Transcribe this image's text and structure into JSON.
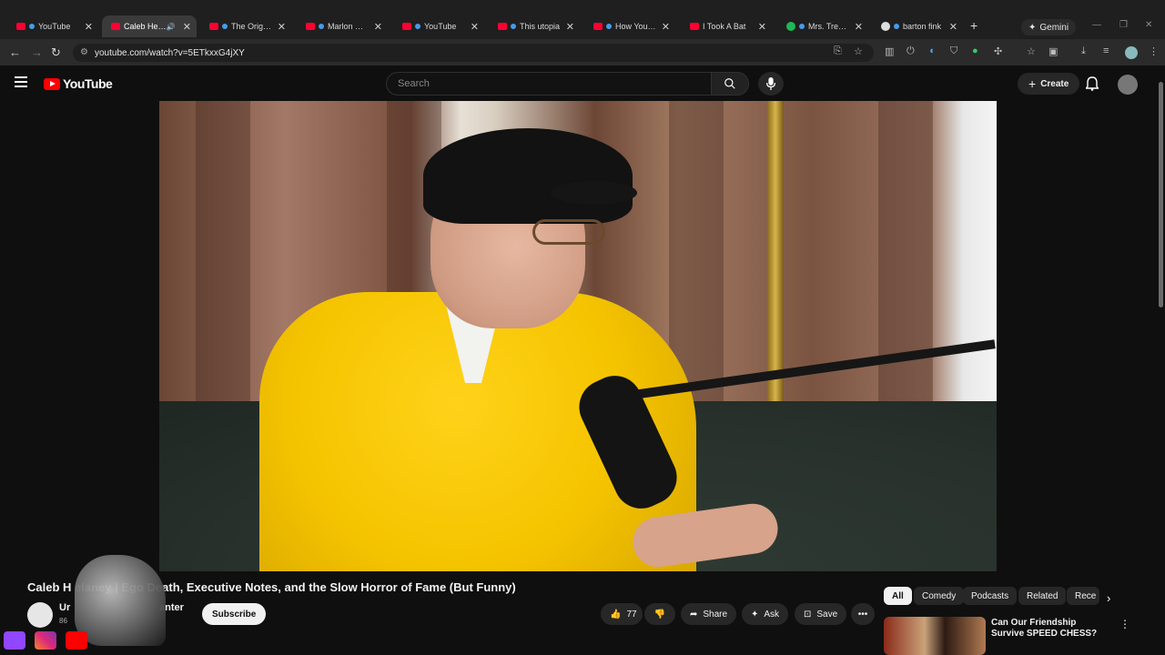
{
  "browser": {
    "tabs": [
      {
        "title": "YouTube",
        "icon": "youtube-icon"
      },
      {
        "title": "Caleb Hearo",
        "icon": "youtube-icon",
        "audio": true
      },
      {
        "title": "The Original",
        "icon": "youtube-icon"
      },
      {
        "title": "Marlon Gets",
        "icon": "youtube-icon"
      },
      {
        "title": "YouTube",
        "icon": "youtube-icon"
      },
      {
        "title": "This utopia",
        "icon": "youtube-icon"
      },
      {
        "title": "How Your Pe",
        "icon": "youtube-icon"
      },
      {
        "title": "I Took A Bat",
        "icon": "youtube-icon"
      },
      {
        "title": "Mrs. Trends",
        "icon": "spotify-icon"
      },
      {
        "title": "barton fink",
        "icon": "google-icon"
      }
    ],
    "gemini_label": "Gemini",
    "url": "youtube.com/watch?v=5ETkxxG4jXY"
  },
  "youtube": {
    "logo_text": "YouTube",
    "search_placeholder": "Search",
    "create_label": "Create"
  },
  "video": {
    "title": "Caleb H                elaney | Ego Death, Executive Notes, and the Slow Horror of Fame (But Funny)",
    "channel_name_prefix": "Ur",
    "channel_name_suffix": "anter",
    "subscribers": "86",
    "subscribe_label": "Subscribe",
    "likes": "77",
    "share_label": "Share",
    "ask_label": "Ask",
    "save_label": "Save"
  },
  "chips": [
    "All",
    "Comedy",
    "Podcasts",
    "Related",
    "Rece"
  ],
  "recommendation": {
    "title": "Can Our Friendship Survive SPEED CHESS?"
  },
  "colors": {
    "brand_red": "#ff0000",
    "background": "#0f0f0f",
    "surface": "#272727"
  }
}
